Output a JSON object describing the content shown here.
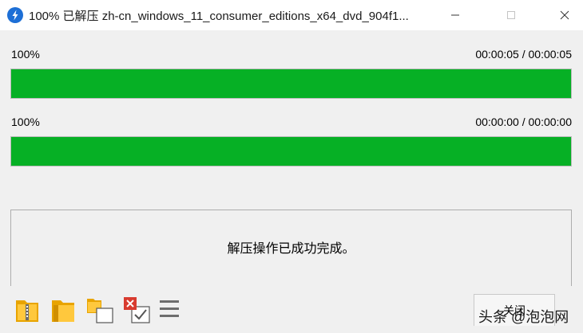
{
  "window": {
    "title": "100% 已解压 zh-cn_windows_11_consumer_editions_x64_dvd_904f1...",
    "icon": "bandizip-app-icon"
  },
  "progress_1": {
    "percent_label": "100%",
    "time_label": "00:00:05 / 00:00:05",
    "fraction": 1.0
  },
  "progress_2": {
    "percent_label": "100%",
    "time_label": "00:00:00 / 00:00:00",
    "fraction": 1.0
  },
  "status": {
    "message": "解压操作已成功完成。"
  },
  "toolbar": {
    "icons": [
      "open-archive-icon",
      "open-folder-icon",
      "copy-files-icon",
      "delete-archive-icon",
      "menu-icon"
    ]
  },
  "buttons": {
    "close_label": "关闭"
  },
  "watermark": {
    "text": "头条 @泡泡网"
  },
  "colors": {
    "progress_fill": "#06b025",
    "background": "#f0f0f0",
    "titlebar": "#ffffff"
  }
}
